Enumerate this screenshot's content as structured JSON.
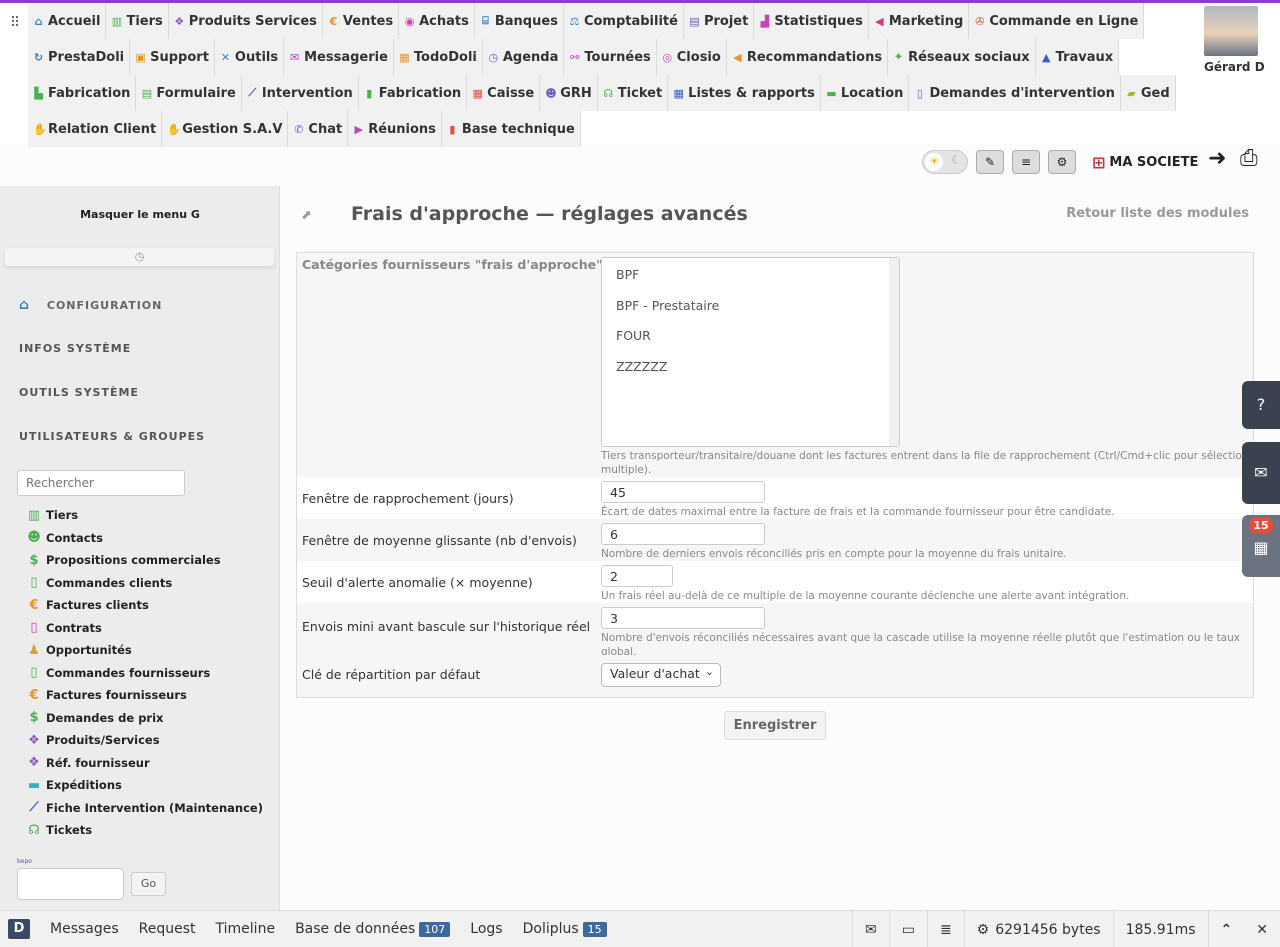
{
  "menu": {
    "rows": [
      [
        {
          "label": "Accueil",
          "icon": "home-icon",
          "glyph": "⌂",
          "color": "#3b82c4"
        },
        {
          "label": "Tiers",
          "icon": "building-icon",
          "glyph": "▥",
          "color": "#4caf50"
        },
        {
          "label": "Produits Services",
          "icon": "cubes-icon",
          "glyph": "❖",
          "color": "#8a5cc4"
        },
        {
          "label": "Ventes",
          "icon": "euro-icon",
          "glyph": "€",
          "color": "#e8942e"
        },
        {
          "label": "Achats",
          "icon": "coins-icon",
          "glyph": "◉",
          "color": "#c545b8"
        },
        {
          "label": "Banques",
          "icon": "bank-icon",
          "glyph": "⌸",
          "color": "#3b82c4"
        },
        {
          "label": "Comptabilité",
          "icon": "balance-icon",
          "glyph": "⚖",
          "color": "#3b82c4"
        },
        {
          "label": "Projet",
          "icon": "sitemap-icon",
          "glyph": "▤",
          "color": "#6b5cc4"
        },
        {
          "label": "Statistiques",
          "icon": "chart-icon",
          "glyph": "▟",
          "color": "#c545b8"
        },
        {
          "label": "Marketing",
          "icon": "bullhorn-icon",
          "glyph": "◀",
          "color": "#d63384"
        },
        {
          "label": "Commande en Ligne",
          "icon": "pinwheel-icon",
          "glyph": "✇",
          "color": "#e05030"
        }
      ],
      [
        {
          "label": "PrestaDoli",
          "icon": "sync-icon",
          "glyph": "↻",
          "color": "#3b82c4"
        },
        {
          "label": "Support",
          "icon": "briefcase-icon",
          "glyph": "▣",
          "color": "#e8942e"
        },
        {
          "label": "Outils",
          "icon": "tools-icon",
          "glyph": "✕",
          "color": "#3b82c4"
        },
        {
          "label": "Messagerie",
          "icon": "inbox-icon",
          "glyph": "✉",
          "color": "#c545b8"
        },
        {
          "label": "TodoDoli",
          "icon": "calendar-check-icon",
          "glyph": "▦",
          "color": "#e8942e"
        },
        {
          "label": "Agenda",
          "icon": "clock-icon",
          "glyph": "◷",
          "color": "#6b5cc4"
        },
        {
          "label": "Tournées",
          "icon": "route-icon",
          "glyph": "⚯",
          "color": "#c545b8"
        },
        {
          "label": "Closio",
          "icon": "target-icon",
          "glyph": "◎",
          "color": "#c545b8"
        },
        {
          "label": "Recommandations",
          "icon": "megaphone-icon",
          "glyph": "◀",
          "color": "#e8942e"
        },
        {
          "label": "Réseaux sociaux",
          "icon": "broadcast-icon",
          "glyph": "⌖",
          "color": "#4caf50"
        },
        {
          "label": "Travaux",
          "icon": "hardhat-icon",
          "glyph": "▲",
          "color": "#3b5cc4"
        }
      ],
      [
        {
          "label": "Fabrication",
          "icon": "industry-icon",
          "glyph": "▙",
          "color": "#4caf50"
        },
        {
          "label": "Formulaire",
          "icon": "form-icon",
          "glyph": "▤",
          "color": "#4caf50"
        },
        {
          "label": "Intervention",
          "icon": "wrench-icon",
          "glyph": "⟋",
          "color": "#3b5cc4"
        },
        {
          "label": "Fabrication",
          "icon": "scroll-icon",
          "glyph": "▮",
          "color": "#4caf50"
        },
        {
          "label": "Caisse",
          "icon": "cash-register-icon",
          "glyph": "▦",
          "color": "#e84c3d"
        },
        {
          "label": "GRH",
          "icon": "users-icon",
          "glyph": "☻",
          "color": "#6b5cc4"
        },
        {
          "label": "Ticket",
          "icon": "headset-icon",
          "glyph": "☊",
          "color": "#4caf50"
        },
        {
          "label": "Listes & rapports",
          "icon": "table-icon",
          "glyph": "▦",
          "color": "#3b5cc4"
        },
        {
          "label": "Location",
          "icon": "truck-icon",
          "glyph": "▬",
          "color": "#4caf50"
        },
        {
          "label": "Demandes d'intervention",
          "icon": "file-icon",
          "glyph": "▯",
          "color": "#6b5cc4"
        },
        {
          "label": "Ged",
          "icon": "folder-icon",
          "glyph": "▰",
          "color": "#a8b820"
        }
      ],
      [
        {
          "label": "Relation Client",
          "icon": "handshake-icon",
          "glyph": "✋",
          "color": "#c545b8"
        },
        {
          "label": "Gestion S.A.V",
          "icon": "handshake-icon",
          "glyph": "✋",
          "color": "#4caf50"
        },
        {
          "label": "Chat",
          "icon": "comments-icon",
          "glyph": "✆",
          "color": "#6b5cc4"
        },
        {
          "label": "Réunions",
          "icon": "video-icon",
          "glyph": "▶",
          "color": "#c545b8"
        },
        {
          "label": "Base technique",
          "icon": "book-icon",
          "glyph": "▮",
          "color": "#e84c3d"
        }
      ]
    ]
  },
  "user": {
    "name": "Gérard D"
  },
  "toolbar": {
    "company": "MA SOCIETE"
  },
  "sidebar": {
    "hide_menu": "Masquer le menu G",
    "sections": {
      "config": "CONFIGURATION",
      "infos": "INFOS SYSTÈME",
      "outils": "OUTILS SYSTÈME",
      "users": "UTILISATEURS & GROUPES"
    },
    "search_placeholder": "Rechercher",
    "items": [
      {
        "label": "Tiers",
        "icon": "building-icon",
        "glyph": "▥",
        "color": "#4caf50"
      },
      {
        "label": "Contacts",
        "icon": "users-icon",
        "glyph": "☻",
        "color": "#4caf50"
      },
      {
        "label": "Propositions commerciales",
        "icon": "money-bubble-icon",
        "glyph": "$",
        "color": "#4caf50"
      },
      {
        "label": "Commandes clients",
        "icon": "file-icon",
        "glyph": "▯",
        "color": "#4caf50"
      },
      {
        "label": "Factures clients",
        "icon": "euro-icon",
        "glyph": "€",
        "color": "#e8942e"
      },
      {
        "label": "Contrats",
        "icon": "file-contract-icon",
        "glyph": "▯",
        "color": "#c545b8"
      },
      {
        "label": "Opportunités",
        "icon": "person-icon",
        "glyph": "♟",
        "color": "#d4a040"
      },
      {
        "label": "Commandes fournisseurs",
        "icon": "file-icon",
        "glyph": "▯",
        "color": "#4caf50"
      },
      {
        "label": "Factures fournisseurs",
        "icon": "euro-icon",
        "glyph": "€",
        "color": "#e8942e"
      },
      {
        "label": "Demandes de prix",
        "icon": "money-bubble-icon",
        "glyph": "$",
        "color": "#4caf50"
      },
      {
        "label": "Produits/Services",
        "icon": "cubes-icon",
        "glyph": "❖",
        "color": "#8a5cc4"
      },
      {
        "label": "Réf. fournisseur",
        "icon": "cubes-icon",
        "glyph": "❖",
        "color": "#8a5cc4"
      },
      {
        "label": "Expéditions",
        "icon": "truck-icon",
        "glyph": "▬",
        "color": "#3bb0c4"
      },
      {
        "label": "Fiche Intervention (Maintenance)",
        "icon": "wrench-icon",
        "glyph": "⟋",
        "color": "#3b5cc4"
      },
      {
        "label": "Tickets",
        "icon": "headset-icon",
        "glyph": "☊",
        "color": "#4caf50"
      }
    ],
    "tiny_label": "bepo",
    "go_label": "Go"
  },
  "page": {
    "title": "Frais d'approche — réglages avancés",
    "back": "Retour liste des modules",
    "categories_label": "Catégories fournisseurs \"frais d'approche\"",
    "categories": [
      "BPF",
      "BPF - Prestataire",
      "FOUR",
      "ZZZZZZ"
    ],
    "categories_help": "Tiers transporteur/transitaire/douane dont les factures entrent dans la file de rapprochement (Ctrl/Cmd+clic pour sélection multiple).",
    "fields": [
      {
        "label": "Fenêtre de rapprochement (jours)",
        "value": "45",
        "help": "Écart de dates maximal entre la facture de frais et la commande fournisseur pour être candidate."
      },
      {
        "label": "Fenêtre de moyenne glissante (nb d'envois)",
        "value": "6",
        "help": "Nombre de derniers envois réconciliés pris en compte pour la moyenne du frais unitaire."
      },
      {
        "label": "Seuil d'alerte anomalie (× moyenne)",
        "value": "2",
        "help": "Un frais réel au-delà de ce multiple de la moyenne courante déclenche une alerte avant intégration."
      },
      {
        "label": "Envois mini avant bascule sur l'historique réel",
        "value": "3",
        "help": "Nombre d'envois réconciliés nécessaires avant que la cascade utilise la moyenne réelle plutôt que l'estimation ou le taux global."
      }
    ],
    "cle_label": "Clé de répartition par défaut",
    "cle_value": "Valeur d'achat",
    "save": "Enregistrer"
  },
  "floating": {
    "agenda_count": "15"
  },
  "debugbar": {
    "tabs": [
      {
        "label": "Messages"
      },
      {
        "label": "Request"
      },
      {
        "label": "Timeline"
      },
      {
        "label": "Base de données",
        "badge": "107"
      },
      {
        "label": "Logs"
      },
      {
        "label": "Doliplus",
        "badge": "15"
      }
    ],
    "memory": "6291456 bytes",
    "time": "185.91ms"
  }
}
